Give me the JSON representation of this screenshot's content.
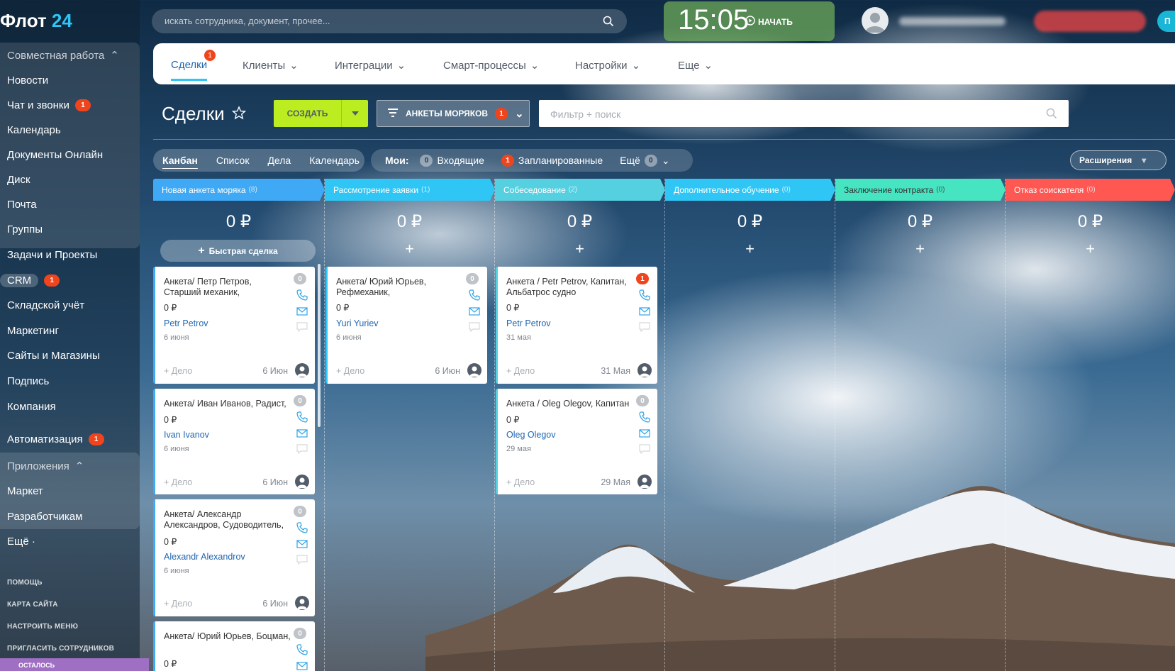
{
  "logo": {
    "word": "Флот",
    "num": "24"
  },
  "topbar": {
    "search_placeholder": "искать сотрудника, документ, прочее...",
    "time": "15:05",
    "start": "НАЧАТЬ",
    "teal_label": "П"
  },
  "sidebar": {
    "collab": "Совместная работа",
    "items": [
      "Новости",
      "Чат и звонки",
      "Календарь",
      "Документы Онлайн",
      "Диск",
      "Почта",
      "Группы",
      "Задачи и Проекты",
      "CRM",
      "Складской учёт",
      "Маркетинг",
      "Сайты и Магазины",
      "Подпись",
      "Компания",
      "Автоматизация"
    ],
    "chat_badge": "1",
    "crm_badge": "1",
    "auto_badge": "1",
    "apps": "Приложения",
    "market": "Маркет",
    "devs": "Разработчикам",
    "more": "Ещё ·",
    "help": "ПОМОЩЬ",
    "sitemap": "КАРТА САЙТА",
    "menu": "НАСТРОИТЬ МЕНЮ",
    "invite": "ПРИГЛАСИТЬ СОТРУДНИКОВ",
    "left": "ОСТАЛОСЬ"
  },
  "tabs": {
    "deals": "Сделки",
    "deals_count": "1",
    "clients": "Клиенты",
    "integrations": "Интеграции",
    "smart": "Смарт-процессы",
    "settings": "Настройки",
    "more": "Еще"
  },
  "page": {
    "title": "Сделки",
    "create": "СОЗДАТЬ",
    "category": "АНКЕТЫ МОРЯКОВ",
    "category_count": "1",
    "filter_placeholder": "Фильтр + поиск"
  },
  "views": {
    "kanban": "Канбан",
    "list": "Список",
    "tasks": "Дела",
    "calendar": "Календарь"
  },
  "moi": {
    "label": "Мои:",
    "incoming_count": "0",
    "incoming": "Входящие",
    "planned_count": "1",
    "planned": "Запланированные",
    "more": "Ещё",
    "more_count": "0"
  },
  "extensions": "Расширения",
  "colors": {
    "col1": "#3fa9f5",
    "col2": "#2fc6f6",
    "col3": "#55d0e0",
    "col4": "#2fc6f6",
    "col5": "#47e4c2",
    "col6": "#ff5752",
    "create": "#bbed21"
  },
  "columns": [
    {
      "title": "Новая анкета моряка",
      "count": "(8)",
      "sum": "0 ₽",
      "quick": "Быстрая сделка"
    },
    {
      "title": "Рассмотрение заявки",
      "count": "(1)",
      "sum": "0 ₽",
      "plus": "+"
    },
    {
      "title": "Собеседование",
      "count": "(2)",
      "sum": "0 ₽",
      "plus": "+"
    },
    {
      "title": "Дополнительное обучение",
      "count": "(0)",
      "sum": "0 ₽",
      "plus": "+"
    },
    {
      "title": "Заключение контракта",
      "count": "(0)",
      "sum": "0 ₽",
      "plus": "+"
    },
    {
      "title": "Отказ соискателя",
      "count": "(0)",
      "sum": "0 ₽",
      "plus": "+"
    }
  ],
  "cards": [
    {
      "title": "Анкета/ Петр Петров, Старший механик,",
      "amount": "0 ₽",
      "contact": "Petr Petrov",
      "date": "6 июня",
      "add": "+ Дело",
      "short": "6 Июн",
      "counter": "0"
    },
    {
      "title": "Анкета/ Иван Иванов, Радист,",
      "amount": "0 ₽",
      "contact": "Ivan Ivanov",
      "date": "6 июня",
      "add": "+ Дело",
      "short": "6 Июн",
      "counter": "0"
    },
    {
      "title": "Анкета/ Александр Александров, Судоводитель,",
      "amount": "0 ₽",
      "contact": "Alexandr Alexandrov",
      "date": "6 июня",
      "add": "+ Дело",
      "short": "6 Июн",
      "counter": "0"
    },
    {
      "title": "Анкета/ Юрий Юрьев, Боцман,",
      "amount": "0 ₽",
      "counter": "0"
    },
    {
      "title": "Анкета/ Юрий Юрьев, Рефмеханик,",
      "amount": "0 ₽",
      "contact": "Yuri Yuriev",
      "date": "6 июня",
      "add": "+ Дело",
      "short": "6 Июн",
      "counter": "0"
    },
    {
      "title": "Анкета / Petr Petrov, Капитан, Альбатрос судно",
      "amount": "0 ₽",
      "contact": "Petr Petrov",
      "date": "31 мая",
      "add": "+ Дело",
      "short": "31 Мая",
      "counter": "1"
    },
    {
      "title": "Анкета / Oleg Olegov, Капитан",
      "amount": "0 ₽",
      "contact": "Oleg Olegov",
      "date": "29 мая",
      "add": "+ Дело",
      "short": "29 Мая",
      "counter": "0"
    }
  ]
}
